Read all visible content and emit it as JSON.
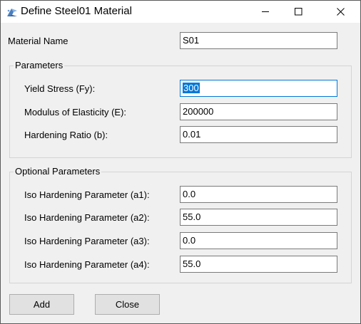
{
  "window": {
    "title": "Define Steel01 Material",
    "controls": {
      "minimize": "minimize-icon",
      "maximize": "maximize-icon",
      "close": "close-icon"
    }
  },
  "material_name": {
    "label": "Material Name",
    "value": "S01"
  },
  "parameters": {
    "title": "Parameters",
    "fields": [
      {
        "label": "Yield Stress (Fy):",
        "value": "300"
      },
      {
        "label": "Modulus of Elasticity (E):",
        "value": "200000"
      },
      {
        "label": "Hardening Ratio (b):",
        "value": "0.01"
      }
    ]
  },
  "optional_parameters": {
    "title": "Optional Parameters",
    "fields": [
      {
        "label": "Iso Hardening Parameter (a1):",
        "value": "0.0"
      },
      {
        "label": "Iso Hardening Parameter (a2):",
        "value": "55.0"
      },
      {
        "label": "Iso Hardening Parameter (a3):",
        "value": "0.0"
      },
      {
        "label": "Iso Hardening Parameter (a4):",
        "value": "55.0"
      }
    ]
  },
  "buttons": {
    "add": "Add",
    "close": "Close"
  },
  "colors": {
    "selection": "#0078d7",
    "focus_border": "#0078d7",
    "background": "#f0f0f0"
  }
}
